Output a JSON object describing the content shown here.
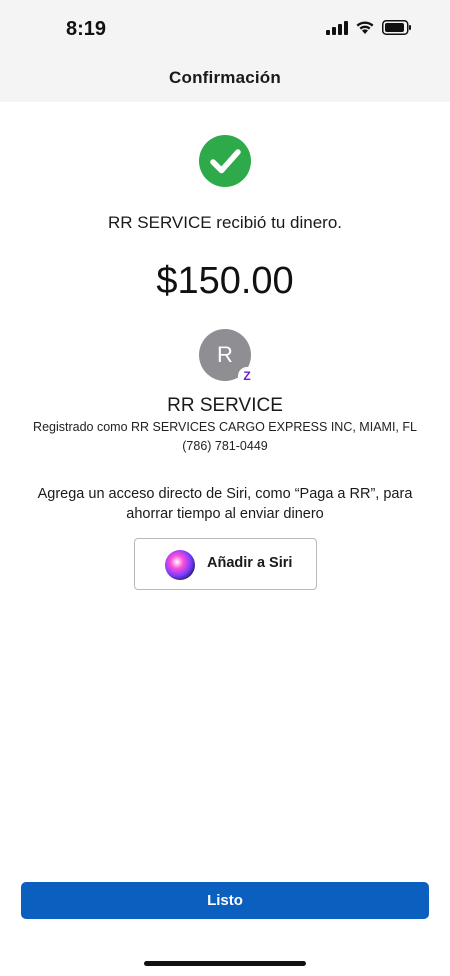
{
  "status_bar": {
    "time": "8:19",
    "icons": [
      "signal-icon",
      "wifi-icon",
      "battery-icon"
    ]
  },
  "header": {
    "title": "Confirmación"
  },
  "confirmation": {
    "status_icon": "checkmark-circle-icon",
    "accent_color": "#2eaa4a",
    "message": "RR SERVICE recibió tu dinero.",
    "amount": "$150.00"
  },
  "recipient": {
    "avatar_initial": "R",
    "badge_icon": "zelle-icon",
    "badge_glyph": "Z",
    "name": "RR SERVICE",
    "registered_as": "Registrado como RR SERVICES CARGO EXPRESS INC, MIAMI, FL",
    "phone": "(786) 781-0449"
  },
  "siri": {
    "description": "Agrega un acceso directo de Siri, como “Paga a RR”, para ahorrar tiempo al enviar dinero",
    "button_label": "Añadir a Siri",
    "icon": "siri-icon"
  },
  "footer": {
    "done_label": "Listo",
    "button_color": "#0b5fbf"
  }
}
